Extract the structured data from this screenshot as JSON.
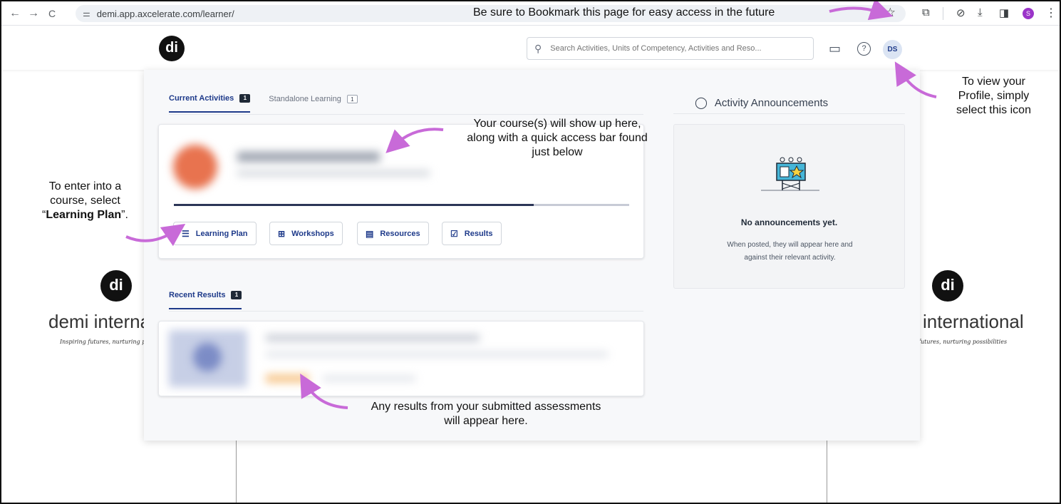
{
  "browser": {
    "url": "demi.app.axcelerate.com/learner/",
    "back_icon": "←",
    "forward_icon": "→",
    "reload_icon": "C",
    "profile_initial": "S"
  },
  "header": {
    "logo": "di",
    "search_placeholder": "Search Activities, Units of Competency, Activities and Reso...",
    "avatar": "DS"
  },
  "background": {
    "logo": "di",
    "wordmark_left": "demi interna",
    "wordmark_right": "international",
    "tagline_left": "Inspiring futures, nurturing p",
    "tagline_right": "futures, nurturing possibilities"
  },
  "tabs": [
    {
      "label": "Current Activities",
      "count": "1"
    },
    {
      "label": "Standalone Learning",
      "count": "1"
    }
  ],
  "course": {
    "progress": 0.79,
    "quick_access": [
      {
        "label": "Learning Plan",
        "icon": "list-icon"
      },
      {
        "label": "Workshops",
        "icon": "presentation-icon"
      },
      {
        "label": "Resources",
        "icon": "document-icon"
      },
      {
        "label": "Results",
        "icon": "clipboard-check-icon"
      }
    ]
  },
  "recent_results": {
    "label": "Recent Results",
    "count": "1"
  },
  "announcements": {
    "heading": "Activity Announcements",
    "empty_title": "No announcements yet.",
    "empty_text": "When posted, they will appear here and against their relevant activity."
  },
  "annotations": {
    "bookmark": "Be sure to Bookmark this page for easy access in the future",
    "profile": [
      "To view your",
      "Profile, simply",
      "select this icon"
    ],
    "course": [
      "Your course(s) will show up here,",
      "along with a quick access bar found",
      "just below"
    ],
    "learning_plan_a": "To enter into a",
    "learning_plan_b": "course, select",
    "learning_plan_quote_open": "“",
    "learning_plan_bold": "Learning Plan",
    "learning_plan_quote_close": "”.",
    "results": [
      "Any results from your submitted assessments",
      "will appear here."
    ]
  },
  "colors": {
    "accent": "#1e3a8a",
    "arrow": "#c86ad8",
    "progress": "#2c3657"
  }
}
